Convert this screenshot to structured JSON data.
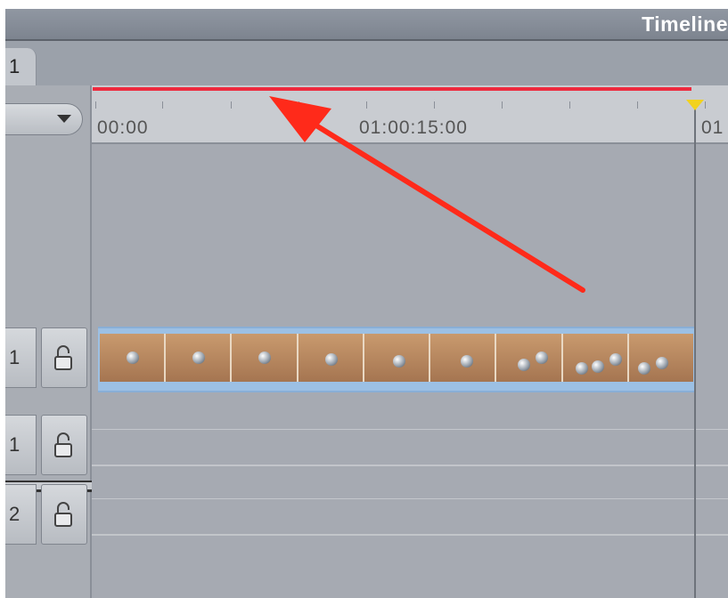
{
  "window": {
    "title": "Timeline"
  },
  "tab": {
    "label": "1"
  },
  "ruler": {
    "start_label": "00:00",
    "mid_label": "01:00:15:00",
    "end_label": "01"
  },
  "tracks": {
    "video": [
      {
        "label": "1"
      }
    ],
    "audio": [
      {
        "label": "1"
      },
      {
        "label": "2"
      }
    ]
  },
  "colors": {
    "render_bar": "#ee2a3e",
    "annotation_arrow": "#ff2a1a",
    "playhead": "#f2d21d",
    "clip": "#9cc0e4"
  },
  "icons": [
    "dropdown-arrow-icon",
    "lock-icon",
    "playhead-icon",
    "annotation-arrow"
  ]
}
